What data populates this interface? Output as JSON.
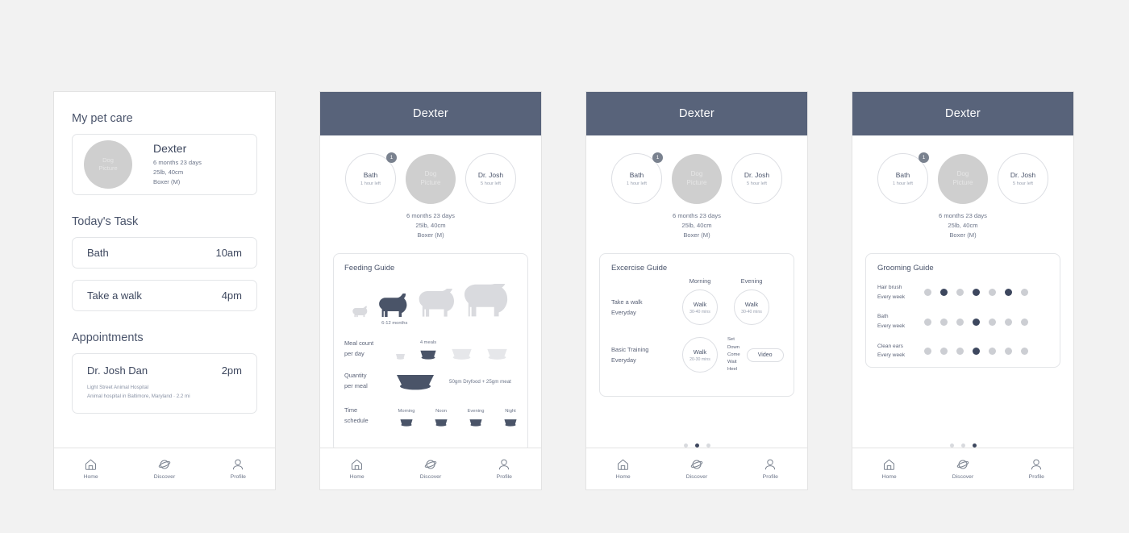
{
  "app": {
    "title": "Dexter"
  },
  "screen1": {
    "sections": {
      "pet_care": "My pet care",
      "todays_task": "Today's Task",
      "appointments": "Appointments"
    },
    "pet": {
      "avatar_line1": "Dog",
      "avatar_line2": "Picture",
      "name": "Dexter",
      "age": "6 months 23 days",
      "size": "25lb, 40cm",
      "breed": "Boxer (M)"
    },
    "tasks": [
      {
        "name": "Bath",
        "time": "10am"
      },
      {
        "name": "Take a walk",
        "time": "4pm"
      }
    ],
    "appointment": {
      "name": "Dr. Josh Dan",
      "time": "2pm",
      "place": "Light Street Animal Hospital",
      "detail": "Animal hospital in Baltimore, Maryland · 2.2 mi"
    }
  },
  "top_circles": [
    {
      "label": "Bath",
      "sub": "1 hour left",
      "badge": "1",
      "style": "outline"
    },
    {
      "label_line1": "Dog",
      "label_line2": "Picture",
      "style": "filled"
    },
    {
      "label": "Dr. Josh",
      "sub": "5 hour left",
      "style": "outline"
    }
  ],
  "pet_meta": {
    "age": "6 months 23 days",
    "size": "25lb, 40cm",
    "breed": "Boxer (M)"
  },
  "feeding_guide": {
    "title": "Feeding Guide",
    "stage_caption": "6-12 months",
    "rows": {
      "meal_count_label": "Meal count\nper day",
      "meal_count_caption": "4 meals",
      "quantity_label": "Quantity\nper meal",
      "quantity_text": "50gm Dryfood + 25gm meat",
      "time_label": "Time\nschedule"
    },
    "times": [
      "Morning",
      "Noon",
      "Evening",
      "Night"
    ]
  },
  "exercise_guide": {
    "title": "Excercise Guide",
    "columns": [
      "Morning",
      "Evening"
    ],
    "rows": [
      {
        "label": "Take a walk\nEveryday",
        "morning": {
          "label": "Walk",
          "sub": "30-40 mins"
        },
        "evening": {
          "label": "Walk",
          "sub": "30-40 mins"
        }
      },
      {
        "label": "Basic Training\nEveryday",
        "morning": {
          "label": "Walk",
          "sub": "20-30 mins"
        },
        "commands": "Set\nDown\nCome\nWait\nHeel",
        "video_label": "Video"
      }
    ]
  },
  "grooming_guide": {
    "title": "Grooming Guide",
    "rows": [
      {
        "label": "Hair brush\nEvery week",
        "dots": [
          0,
          1,
          0,
          1,
          0,
          1,
          0
        ]
      },
      {
        "label": "Bath\nEvery week",
        "dots": [
          0,
          0,
          0,
          1,
          0,
          0,
          0
        ]
      },
      {
        "label": "Clean ears\nEvery week",
        "dots": [
          0,
          0,
          0,
          1,
          0,
          0,
          0
        ]
      }
    ]
  },
  "pagers": {
    "screen2_active": 0,
    "screen3_active": 1,
    "screen4_active": 2,
    "count": 3
  },
  "tabbar": {
    "items": [
      {
        "label": "Home",
        "icon": "home-icon"
      },
      {
        "label": "Discover",
        "icon": "planet-icon"
      },
      {
        "label": "Profile",
        "icon": "person-icon"
      }
    ]
  },
  "colors": {
    "header": "#58637a",
    "text_dark": "#3d475e",
    "text_muted": "#6b7488",
    "dot_on": "#3d475e",
    "dot_off": "#ccced3"
  }
}
